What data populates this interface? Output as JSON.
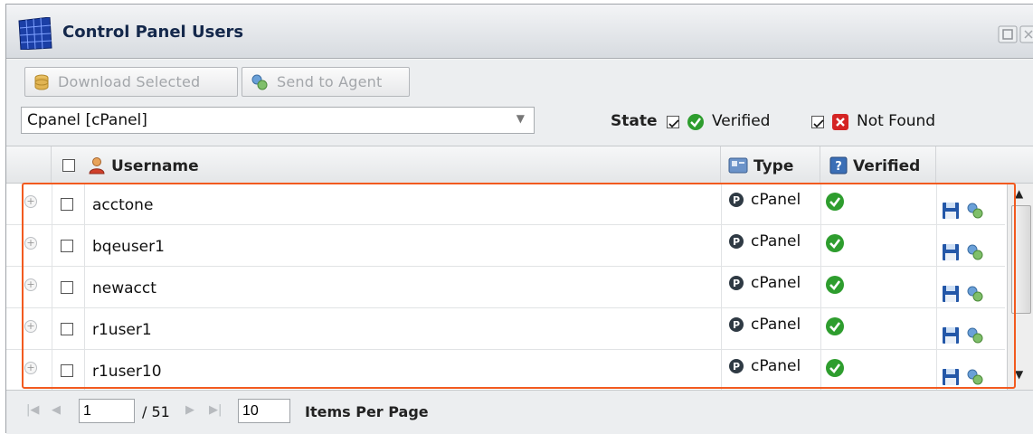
{
  "window": {
    "title": "Control Panel Users"
  },
  "toolbar": {
    "download_label": "Download Selected",
    "send_label": "Send to Agent"
  },
  "filter": {
    "selected_option": "Cpanel [cPanel]",
    "state_label": "State",
    "verified_label": "Verified",
    "not_found_label": "Not Found",
    "verified_checked": true,
    "not_found_checked": true
  },
  "grid": {
    "columns": {
      "username": "Username",
      "type": "Type",
      "verified": "Verified"
    },
    "rows": [
      {
        "username": "acctone",
        "type": "cPanel"
      },
      {
        "username": "bqeuser1",
        "type": "cPanel"
      },
      {
        "username": "newacct",
        "type": "cPanel"
      },
      {
        "username": "r1user1",
        "type": "cPanel"
      },
      {
        "username": "r1user10",
        "type": "cPanel"
      }
    ]
  },
  "pager": {
    "current_page": "1",
    "total_pages": "/ 51",
    "items_per_page": "10",
    "items_per_page_label": "Items Per Page"
  },
  "colors": {
    "highlight": "#f25a1f",
    "verified_green": "#2e9d2e",
    "not_found_red": "#d42424"
  }
}
